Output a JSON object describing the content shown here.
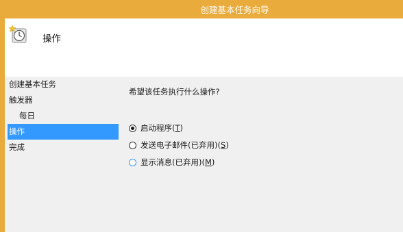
{
  "window": {
    "title": "创建基本任务向导"
  },
  "header": {
    "title": "操作",
    "icon": "task-clock-icon"
  },
  "sidebar": {
    "items": [
      {
        "label": "创建基本任务"
      },
      {
        "label": "触发器"
      },
      {
        "label": "每日"
      },
      {
        "label": "操作"
      },
      {
        "label": "完成"
      }
    ],
    "selected": "操作"
  },
  "main": {
    "question": "希望该任务执行什么操作?",
    "options": [
      {
        "label": "启动程序(",
        "key": "T",
        "close": ")",
        "checked": true
      },
      {
        "label": "发送电子邮件(已弃用)(",
        "key": "S",
        "close": ")",
        "checked": false
      },
      {
        "label": "显示消息(已弃用)(",
        "key": "M",
        "close": ")",
        "checked": false
      }
    ]
  },
  "colors": {
    "accent": "#e9ac3c",
    "selection": "#3399ff"
  }
}
